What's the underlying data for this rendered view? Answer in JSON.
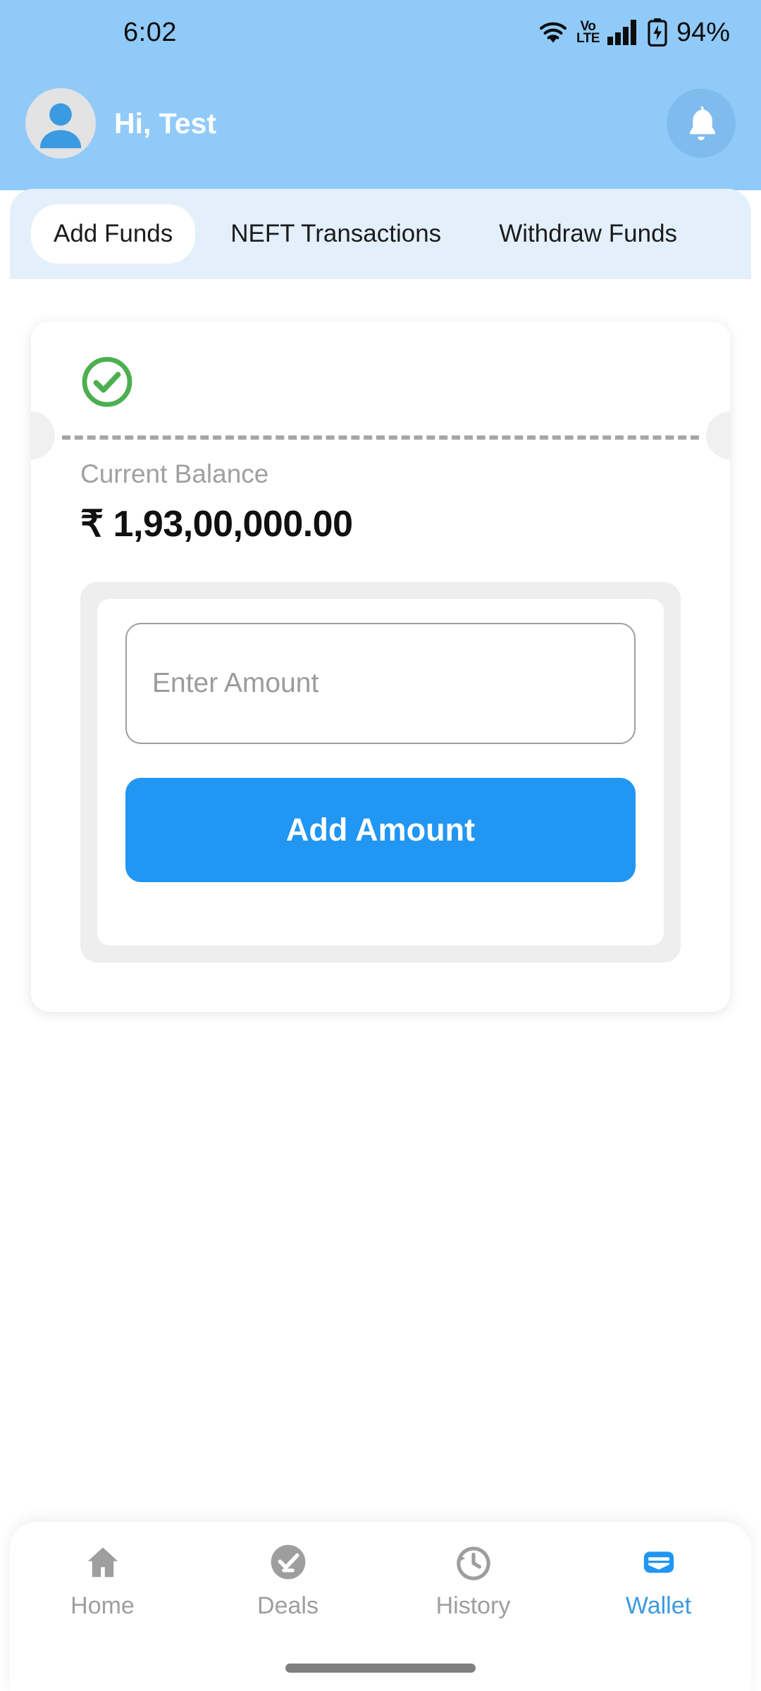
{
  "status_bar": {
    "time": "6:02",
    "wifi_icon": "wifi-icon",
    "volte_top": "Vo",
    "volte_bottom": "LTE",
    "signal_icon": "cellular-signal-icon",
    "battery_icon": "battery-charging-icon",
    "battery_percent": "94%"
  },
  "header": {
    "avatar_icon": "person-avatar-icon",
    "greeting": "Hi, Test",
    "notification_icon": "bell-icon"
  },
  "tabs": [
    {
      "label": "Add Funds",
      "active": true
    },
    {
      "label": "NEFT Transactions",
      "active": false
    },
    {
      "label": "Withdraw Funds",
      "active": false
    }
  ],
  "wallet_card": {
    "status_icon": "check-circle-icon",
    "balance_label": "Current Balance",
    "balance_value": "₹ 1,93,00,000.00",
    "amount_placeholder": "Enter Amount",
    "amount_value": "",
    "submit_label": "Add Amount"
  },
  "bottom_nav": [
    {
      "label": "Home",
      "icon": "home-icon",
      "active": false
    },
    {
      "label": "Deals",
      "icon": "check-circle-filled-icon",
      "active": false
    },
    {
      "label": "History",
      "icon": "clock-history-icon",
      "active": false
    },
    {
      "label": "Wallet",
      "icon": "wallet-icon",
      "active": true
    }
  ],
  "colors": {
    "header_blue": "#90caf9",
    "tab_strip_blue": "#e3f0fc",
    "accent_blue": "#2196f3",
    "active_nav_blue": "#3b9ae1",
    "success_green": "#4caf50",
    "panel_gray": "#eeeeee"
  }
}
